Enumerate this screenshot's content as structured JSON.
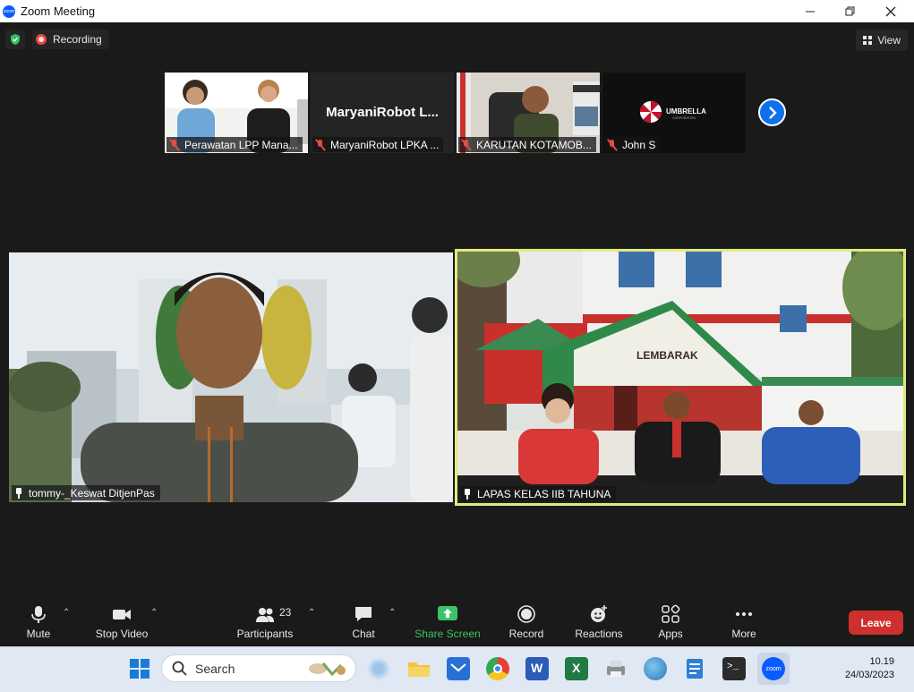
{
  "window": {
    "title": "Zoom Meeting"
  },
  "topbar": {
    "recording_label": "Recording",
    "view_label": "View"
  },
  "thumbnails": [
    {
      "name": "Perawatan LPP Mana..."
    },
    {
      "name": "MaryaniRobot LPKA ...",
      "display_text": "MaryaniRobot  L..."
    },
    {
      "name": "KARUTAN KOTAMOB..."
    },
    {
      "name": "John S",
      "logo_text": "UMBRELLA",
      "logo_subtext": "CORPORATION"
    }
  ],
  "main_tiles": [
    {
      "name": "tommy-_Keswat DitjenPas"
    },
    {
      "name": "LAPAS KELAS IIB TAHUNA",
      "sign_text": "LEMBARAK"
    }
  ],
  "toolbar": {
    "mute": "Mute",
    "stop_video": "Stop Video",
    "participants": "Participants",
    "participants_count": "23",
    "chat": "Chat",
    "share_screen": "Share Screen",
    "record": "Record",
    "reactions": "Reactions",
    "apps": "Apps",
    "more": "More",
    "leave": "Leave"
  },
  "colors": {
    "share_green": "#3ac467",
    "leave_red": "#cf2f2f",
    "active_speaker": "#e1ea7a",
    "zoom_blue": "#0b5cff"
  },
  "taskbar": {
    "search_label": "Search",
    "time": "10.19",
    "date": "24/03/2023"
  }
}
